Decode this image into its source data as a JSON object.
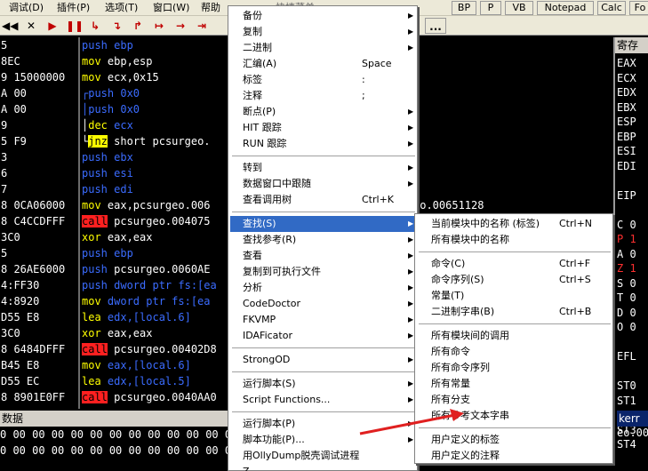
{
  "menubar": {
    "items": [
      "调试(D)",
      "插件(P)",
      "选项(T)",
      "窗口(W)",
      "帮助"
    ],
    "partial_title": "快捷菜单",
    "buttons": [
      "BP",
      "P",
      "VB",
      "Notepad",
      "Calc",
      "Fo"
    ]
  },
  "toolbar": {
    "buttons": [
      "◀◀",
      "✕",
      "▶",
      "❚❚",
      "↳",
      "↴",
      "↱",
      "↦",
      "→",
      "⇥"
    ],
    "right_label": "..."
  },
  "cpu": {
    "rows": [
      {
        "addr": "5",
        "asm": [
          {
            "t": "push",
            "c": "kw-push"
          },
          {
            "t": " ebp",
            "c": "kw-push"
          }
        ]
      },
      {
        "addr": "8EC",
        "asm": [
          {
            "t": "mov",
            "c": "kw-mov"
          },
          {
            "t": " ebp,esp",
            "c": ""
          }
        ]
      },
      {
        "addr": "9 15000000",
        "asm": [
          {
            "t": "mov",
            "c": "kw-mov"
          },
          {
            "t": " ecx,0x15",
            "c": ""
          }
        ]
      },
      {
        "addr": "A 00",
        "asm": [
          {
            "t": "┌push 0x0",
            "c": "kw-push"
          }
        ]
      },
      {
        "addr": "A 00",
        "asm": [
          {
            "t": "│push 0x0",
            "c": "kw-push"
          }
        ]
      },
      {
        "addr": "9",
        "asm": [
          {
            "t": "│",
            "c": ""
          },
          {
            "t": "dec",
            "c": "kw-dec"
          },
          {
            "t": " ecx",
            "c": "kw-push"
          }
        ]
      },
      {
        "addr": "5 F9",
        "asm": [
          {
            "t": "└",
            "c": ""
          },
          {
            "t": "jnz",
            "c": "kw-jnz"
          },
          {
            "t": " short pcsurgeo.",
            "c": ""
          }
        ]
      },
      {
        "addr": "3",
        "asm": [
          {
            "t": "push ebx",
            "c": "kw-push"
          }
        ]
      },
      {
        "addr": "6",
        "asm": [
          {
            "t": "push esi",
            "c": "kw-push"
          }
        ]
      },
      {
        "addr": "7",
        "asm": [
          {
            "t": "push edi",
            "c": "kw-push"
          }
        ]
      },
      {
        "addr": "8 0CA06000",
        "asm": [
          {
            "t": "mov",
            "c": "kw-mov"
          },
          {
            "t": " eax,pcsurgeo.006",
            "c": ""
          }
        ]
      },
      {
        "addr": "8 C4CCDFFF",
        "asm": [
          {
            "t": "call",
            "c": "kw-call"
          },
          {
            "t": " pcsurgeo.004075",
            "c": ""
          }
        ]
      },
      {
        "addr": "3C0",
        "asm": [
          {
            "t": "xor",
            "c": "kw-xor"
          },
          {
            "t": " eax,eax",
            "c": ""
          }
        ]
      },
      {
        "addr": "5",
        "asm": [
          {
            "t": "push ebp",
            "c": "kw-push"
          }
        ]
      },
      {
        "addr": "8 26AE6000",
        "asm": [
          {
            "t": "push",
            "c": "kw-push"
          },
          {
            "t": " pcsurgeo.0060AE",
            "c": ""
          }
        ]
      },
      {
        "addr": "4:FF30",
        "asm": [
          {
            "t": "push",
            "c": "kw-push"
          },
          {
            "t": " dword ptr fs:[ea",
            "c": "kw-push"
          }
        ]
      },
      {
        "addr": "4:8920",
        "asm": [
          {
            "t": "mov",
            "c": "kw-mov"
          },
          {
            "t": " dword ptr fs:[ea",
            "c": "kw-push"
          }
        ]
      },
      {
        "addr": "D55 E8",
        "asm": [
          {
            "t": "lea",
            "c": "kw-lea"
          },
          {
            "t": " edx,[local.6]",
            "c": "kw-push"
          }
        ]
      },
      {
        "addr": "3C0",
        "asm": [
          {
            "t": "xor",
            "c": "kw-xor"
          },
          {
            "t": " eax,eax",
            "c": ""
          }
        ]
      },
      {
        "addr": "8 6484DFFF",
        "asm": [
          {
            "t": "call",
            "c": "kw-call"
          },
          {
            "t": " pcsurgeo.00402D8",
            "c": ""
          }
        ]
      },
      {
        "addr": "B45 E8",
        "asm": [
          {
            "t": "mov",
            "c": "kw-mov"
          },
          {
            "t": " eax,[local.6]",
            "c": "kw-push"
          }
        ]
      },
      {
        "addr": "D55 EC",
        "asm": [
          {
            "t": "lea",
            "c": "kw-lea"
          },
          {
            "t": " edx,[local.5]",
            "c": "kw-push"
          }
        ]
      },
      {
        "addr": "8 8901E0FF",
        "asm": [
          {
            "t": "call",
            "c": "kw-call"
          },
          {
            "t": " pcsurgeo.0040AA0",
            "c": ""
          }
        ]
      }
    ],
    "comment": "eo.00651128"
  },
  "registers": {
    "title": "寄存",
    "items": [
      {
        "t": "EAX",
        "red": false
      },
      {
        "t": "ECX",
        "red": false
      },
      {
        "t": "EDX",
        "red": false
      },
      {
        "t": "EBX",
        "red": false
      },
      {
        "t": "ESP",
        "red": false
      },
      {
        "t": "EBP",
        "red": false
      },
      {
        "t": "ESI",
        "red": false
      },
      {
        "t": "EDI",
        "red": false
      },
      {
        "t": "",
        "red": false
      },
      {
        "t": "EIP",
        "red": false
      },
      {
        "t": "",
        "red": false
      },
      {
        "t": "C 0",
        "red": false
      },
      {
        "t": "P 1",
        "red": true
      },
      {
        "t": "A 0",
        "red": false
      },
      {
        "t": "Z 1",
        "red": true
      },
      {
        "t": "S 0",
        "red": false
      },
      {
        "t": "T 0",
        "red": false
      },
      {
        "t": "D 0",
        "red": false
      },
      {
        "t": "O 0",
        "red": false
      },
      {
        "t": "",
        "red": false
      },
      {
        "t": "EFL",
        "red": false
      },
      {
        "t": "",
        "red": false
      },
      {
        "t": "ST0",
        "red": false
      },
      {
        "t": "ST1",
        "red": false
      },
      {
        "t": "ST2",
        "red": false
      },
      {
        "t": "ST3",
        "red": false
      },
      {
        "t": "ST4",
        "red": false
      }
    ]
  },
  "dump": {
    "title": "数据",
    "rows": [
      "0 00 00 00 00 00 00 00 00 00 00 00 00 00 00",
      "0 00 00 00 00 00 00 00 00 00 00 00 00 00 00"
    ],
    "stack_title": "kerr",
    "stack_row": "eo.00"
  },
  "context_menu": {
    "items": [
      {
        "label": "备份",
        "sc": "",
        "arrow": true
      },
      {
        "label": "复制",
        "sc": "",
        "arrow": true
      },
      {
        "label": "二进制",
        "sc": "",
        "arrow": true
      },
      {
        "label": "汇编(A)",
        "sc": "Space",
        "arrow": false
      },
      {
        "label": "标签",
        "sc": ":",
        "arrow": false
      },
      {
        "label": "注释",
        "sc": ";",
        "arrow": false
      },
      {
        "label": "断点(P)",
        "sc": "",
        "arrow": true
      },
      {
        "label": "HIT 跟踪",
        "sc": "",
        "arrow": true
      },
      {
        "label": "RUN 跟踪",
        "sc": "",
        "arrow": true
      },
      {
        "sep": true
      },
      {
        "label": "转到",
        "sc": "",
        "arrow": true
      },
      {
        "label": "数据窗口中跟随",
        "sc": "",
        "arrow": true
      },
      {
        "label": "查看调用树",
        "sc": "Ctrl+K",
        "arrow": false
      },
      {
        "sep": true
      },
      {
        "label": "查找(S)",
        "sc": "",
        "arrow": true,
        "sel": true
      },
      {
        "label": "查找参考(R)",
        "sc": "",
        "arrow": true
      },
      {
        "label": "查看",
        "sc": "",
        "arrow": true
      },
      {
        "label": "复制到可执行文件",
        "sc": "",
        "arrow": true
      },
      {
        "label": "分析",
        "sc": "",
        "arrow": true
      },
      {
        "label": "CodeDoctor",
        "sc": "",
        "arrow": true
      },
      {
        "label": "FKVMP",
        "sc": "",
        "arrow": true
      },
      {
        "label": "IDAFicator",
        "sc": "",
        "arrow": true
      },
      {
        "sep": true
      },
      {
        "label": "StrongOD",
        "sc": "",
        "arrow": true
      },
      {
        "sep": true
      },
      {
        "label": "运行脚本(S)",
        "sc": "",
        "arrow": true
      },
      {
        "label": "Script Functions...",
        "sc": "",
        "arrow": true
      },
      {
        "sep": true
      },
      {
        "label": "运行脚本(P)",
        "sc": "",
        "arrow": true
      },
      {
        "label": "脚本功能(P)...",
        "sc": "",
        "arrow": true
      },
      {
        "label": "用OllyDump脱壳调试进程",
        "sc": "",
        "arrow": false
      },
      {
        "label": "Z...",
        "sc": "",
        "arrow": false
      }
    ]
  },
  "submenu": {
    "items": [
      {
        "label": "当前模块中的名称 (标签)",
        "sc": "Ctrl+N"
      },
      {
        "label": "所有模块中的名称",
        "sc": ""
      },
      {
        "sep": true
      },
      {
        "label": "命令(C)",
        "sc": "Ctrl+F"
      },
      {
        "label": "命令序列(S)",
        "sc": "Ctrl+S"
      },
      {
        "label": "常量(T)",
        "sc": ""
      },
      {
        "label": "二进制字串(B)",
        "sc": "Ctrl+B"
      },
      {
        "sep": true
      },
      {
        "label": "所有模块间的调用",
        "sc": ""
      },
      {
        "label": "所有命令",
        "sc": ""
      },
      {
        "label": "所有命令序列",
        "sc": ""
      },
      {
        "label": "所有常量",
        "sc": ""
      },
      {
        "label": "所有分支",
        "sc": ""
      },
      {
        "label": "所有参考文本字串",
        "sc": ""
      },
      {
        "sep": true
      },
      {
        "label": "用户定义的标签",
        "sc": ""
      },
      {
        "label": "用户定义的注释",
        "sc": ""
      }
    ]
  },
  "colors": {
    "selection": "#316ac5",
    "arrow": "#e02020"
  }
}
